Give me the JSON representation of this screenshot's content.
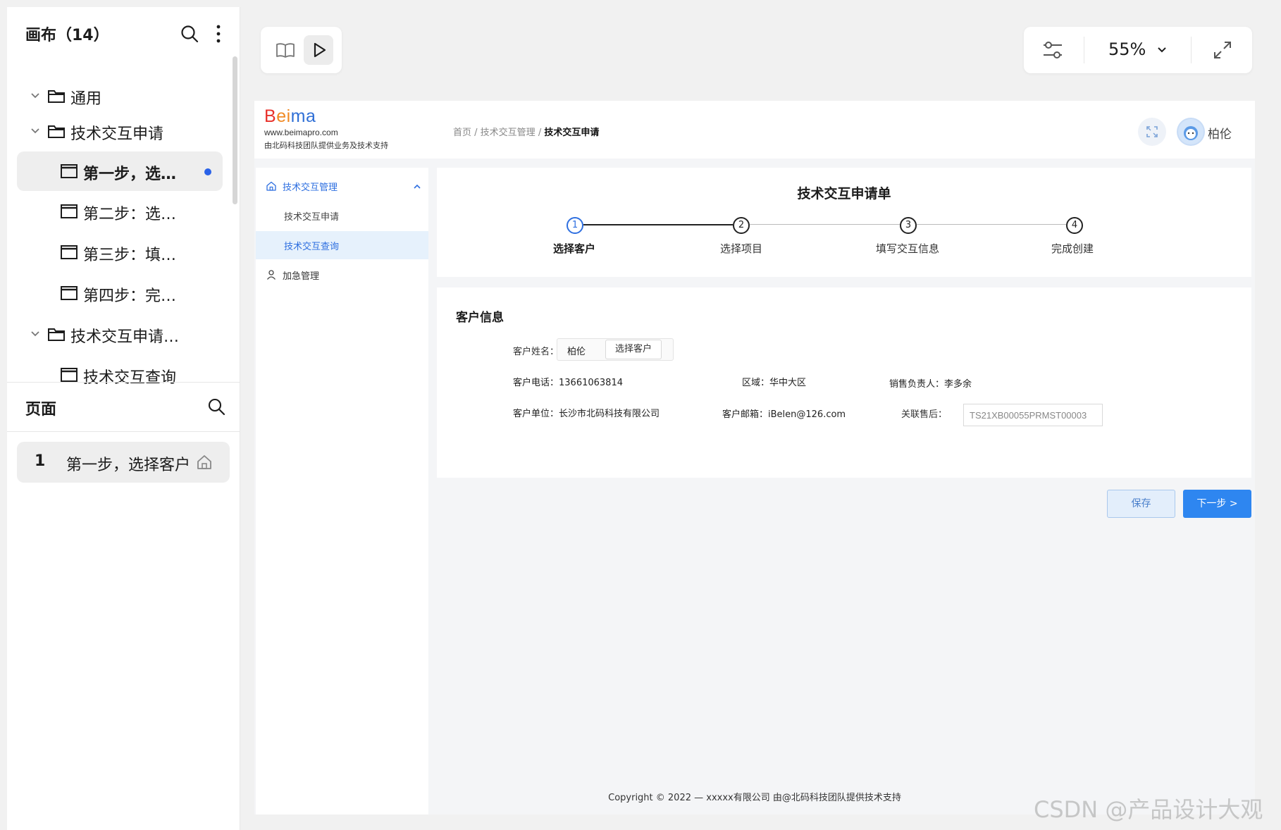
{
  "left_panel": {
    "canvas_title": "画布（14）",
    "tree": [
      {
        "label": "通用"
      },
      {
        "label": "技术交互申请"
      },
      {
        "label": "第一步，选…"
      },
      {
        "label": "第二步：选…"
      },
      {
        "label": "第三步：填…"
      },
      {
        "label": "第四步：完…"
      },
      {
        "label": "技术交互申请…"
      },
      {
        "label": "技术交互查询"
      }
    ],
    "pages_title": "页面",
    "pages": [
      {
        "number": "1",
        "label": "第一步，选择客户"
      }
    ]
  },
  "toolbar": {
    "zoom": "55%"
  },
  "prototype": {
    "logo": {
      "word_parts": [
        "B",
        "ei",
        "ma"
      ],
      "url": "www.beimapro.com",
      "tagline": "由北码科技团队提供业务及技术支持"
    },
    "breadcrumb": {
      "home": "首页",
      "sep": " / ",
      "mid": "技术交互管理",
      "current": "技术交互申请"
    },
    "user_name": "柏伦",
    "side_menu": {
      "group_label": "技术交互管理",
      "sub_items": [
        "技术交互申请",
        "技术交互查询"
      ],
      "other_label": "加急管理"
    },
    "form_title": "技术交互申请单",
    "steps": [
      {
        "num": "1",
        "label": "选择客户"
      },
      {
        "num": "2",
        "label": "选择项目"
      },
      {
        "num": "3",
        "label": "填写交互信息"
      },
      {
        "num": "4",
        "label": "完成创建"
      }
    ],
    "section_title": "客户信息",
    "fields": {
      "name_label": "客户姓名：",
      "name_value": "柏伦",
      "choose_button": "选择客户",
      "phone": "客户电话：13661063814",
      "region": "区域：华中大区",
      "sales": "销售负责人：李多余",
      "company": "客户单位：长沙市北码科技有限公司",
      "email": "客户邮箱：iBelen@126.com",
      "after_sales_label": "关联售后：",
      "after_sales_value": "TS21XB00055PRMST00003"
    },
    "buttons": {
      "save": "保存",
      "next": "下一步 >"
    },
    "copyright": "Copyright © 2022 — xxxxx有限公司    由@北码科技团队提供技术支持"
  },
  "watermark": "CSDN @产品设计大观",
  "colors": {
    "accent": "#2e86f0",
    "active_step": "#2e6fe0",
    "selected_dot": "#2a62e8"
  }
}
